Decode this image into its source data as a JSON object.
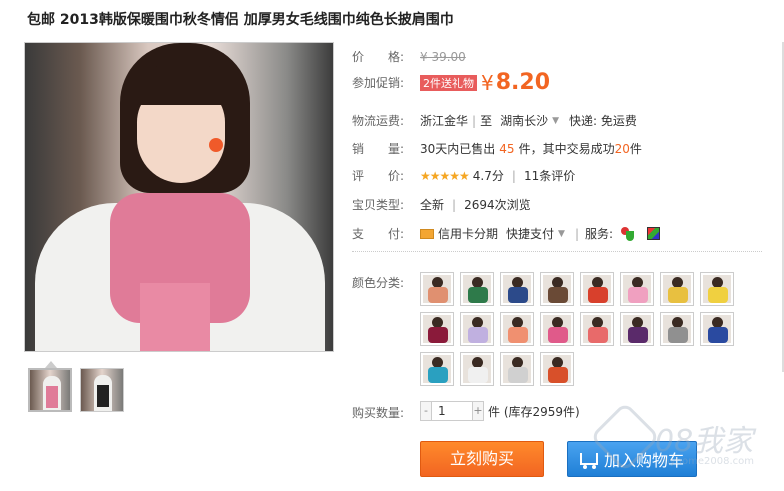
{
  "product": {
    "title": "包邮 2013韩版保暖围巾秋冬情侣 加厚男女毛线围巾纯色长披肩围巾"
  },
  "price": {
    "label": "价　　格:",
    "original": "¥ 39.00"
  },
  "promotion": {
    "label": "参加促销:",
    "tag": "2件送礼物",
    "currency": "¥",
    "price": "8.20"
  },
  "shipping": {
    "label": "物流运费:",
    "from": "浙江金华",
    "to_prefix": "至",
    "to": "湖南长沙",
    "delivery": "快递: 免运费"
  },
  "sales": {
    "label": "销　　量:",
    "prefix": "30天内已售出",
    "count": "45",
    "middle": "件，其中交易成功",
    "success": "20",
    "suffix": "件"
  },
  "rating": {
    "label": "评　　价:",
    "stars": "★★★★★",
    "score": "4.7分",
    "reviews": "11条评价"
  },
  "item_type": {
    "label": "宝贝类型:",
    "condition": "全新",
    "views": "2694次浏览"
  },
  "payment": {
    "label": "支　　付:",
    "credit": "信用卡分期",
    "quick": "快捷支付",
    "service_label": "服务:"
  },
  "colors": {
    "label": "颜色分类:",
    "swatches": [
      {
        "color": "#e09070"
      },
      {
        "color": "#2e7a4a"
      },
      {
        "color": "#2c4a8a"
      },
      {
        "color": "#6a4a36"
      },
      {
        "color": "#d8402c"
      },
      {
        "color": "#f0a0c0"
      },
      {
        "color": "#e8c040"
      },
      {
        "color": "#f0d040"
      },
      {
        "color": "#8a1a3a"
      },
      {
        "color": "#c0b0e0"
      },
      {
        "color": "#f09070"
      },
      {
        "color": "#e05a8a"
      },
      {
        "color": "#e86a6a"
      },
      {
        "color": "#5a2a6a"
      },
      {
        "color": "#909090"
      },
      {
        "color": "#2a4aa0"
      },
      {
        "color": "#2aa0c0"
      },
      {
        "color": "#f0f0f0"
      },
      {
        "color": "#d0d0d0"
      },
      {
        "color": "#d8502a"
      }
    ]
  },
  "quantity": {
    "label": "购买数量:",
    "minus": "-",
    "value": "1",
    "plus": "+",
    "unit": "件 (库存2959件)"
  },
  "actions": {
    "buy_now": "立刻购买",
    "add_cart": "加入购物车"
  },
  "thumbnails": [
    {
      "scarf_color": "#e07b98"
    },
    {
      "scarf_color": "#222222"
    }
  ],
  "watermark": {
    "big": "08我家",
    "small": "myhome2008.com"
  }
}
